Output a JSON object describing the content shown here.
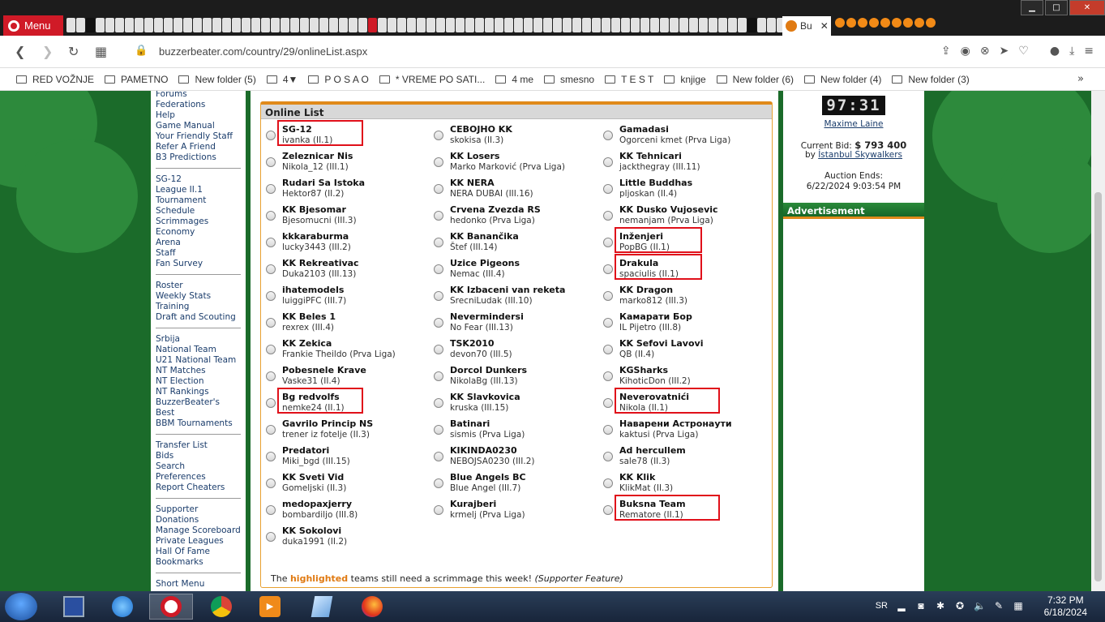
{
  "browser": {
    "menu_label": "Menu",
    "active_tab_title": "Bu",
    "url": "buzzerbeater.com/country/29/onlineList.aspx"
  },
  "bookmarks": [
    "RED VOŽNJE",
    "PAMETNO",
    "New folder (5)",
    "4▼",
    "P O S A O",
    "*  VREME PO SATI...",
    "4 me",
    "smesno",
    "T E S T",
    "knjige",
    "New folder (6)",
    "New folder (4)",
    "New folder (3)"
  ],
  "sidebar": {
    "groups": [
      [
        "Forums",
        "Federations",
        "Help",
        "Game Manual",
        "Your Friendly Staff",
        "Refer A Friend",
        "B3 Predictions"
      ],
      [
        "SG-12",
        "League II.1",
        "Tournament",
        "Schedule",
        "Scrimmages",
        "Economy",
        "Arena",
        "Staff",
        "Fan Survey"
      ],
      [
        "Roster",
        "Weekly Stats",
        "Training",
        "Draft and Scouting"
      ],
      [
        "Srbija",
        "National Team",
        "U21 National Team",
        "NT Matches",
        "NT Election",
        "NT Rankings",
        "BuzzerBeater's Best",
        "BBM Tournaments"
      ],
      [
        "Transfer List",
        "Bids",
        "Search",
        "Preferences",
        "Report Cheaters"
      ],
      [
        "Supporter",
        "Donations",
        "Manage Scoreboard",
        "Private Leagues",
        "Hall Of Fame",
        "Bookmarks"
      ],
      [
        "Short Menu"
      ]
    ]
  },
  "online_list": {
    "title": "Online List",
    "columns": [
      [
        {
          "team": "SG-12",
          "owner": "ivanka (II.1)",
          "highlight": true
        },
        {
          "team": "Zeleznicar Nis",
          "owner": "Nikola_12 (III.1)"
        },
        {
          "team": "Rudari Sa Istoka",
          "owner": "Hektor87 (II.2)"
        },
        {
          "team": "KK Bjesomar",
          "owner": "Bjesomucni (III.3)"
        },
        {
          "team": "kkkaraburma",
          "owner": "lucky3443 (III.2)"
        },
        {
          "team": "KK Rekreativac",
          "owner": "Duka2103 (III.13)"
        },
        {
          "team": "ihatemodels",
          "owner": "luiggiPFC (III.7)"
        },
        {
          "team": "KK Beles 1",
          "owner": "rexrex (III.4)"
        },
        {
          "team": "KK Zekica",
          "owner": "Frankie Theildo (Prva Liga)"
        },
        {
          "team": "Pobesnele Krave",
          "owner": "Vaske31 (II.4)"
        },
        {
          "team": "Bg redvolfs",
          "owner": "nemke24 (II.1)",
          "highlight": true
        },
        {
          "team": "Gavrilo Princip NS",
          "owner": "trener iz fotelje (II.3)"
        },
        {
          "team": "Predatori",
          "owner": "Miki_bgd (III.15)"
        },
        {
          "team": "KK Sveti Vid",
          "owner": "Gomeljski (II.3)"
        },
        {
          "team": "medopaxjerry",
          "owner": "bombardiljo (III.8)"
        },
        {
          "team": "KK Sokolovi",
          "owner": "duka1991 (II.2)"
        }
      ],
      [
        {
          "team": "CEBOJHO KK",
          "owner": "skokisa (II.3)"
        },
        {
          "team": "KK Losers",
          "owner": "Marko Marković (Prva Liga)"
        },
        {
          "team": "KK NERA",
          "owner": "NERA DUBAI (III.16)"
        },
        {
          "team": "Crvena Zvezda RS",
          "owner": "hedonko (Prva Liga)"
        },
        {
          "team": "KK Banančika",
          "owner": "Štef (III.14)"
        },
        {
          "team": "Uzice Pigeons",
          "owner": "Nemac (III.4)"
        },
        {
          "team": "KK Izbaceni van reketa",
          "owner": "SrecniLudak (III.10)"
        },
        {
          "team": "Nevermindersi",
          "owner": "No Fear (III.13)"
        },
        {
          "team": "TSK2010",
          "owner": "devon70 (III.5)"
        },
        {
          "team": "Dorcol Dunkers",
          "owner": "NikolaBg (III.13)"
        },
        {
          "team": "KK Slavkovica",
          "owner": "kruska (III.15)"
        },
        {
          "team": "Batinari",
          "owner": "sismis (Prva Liga)"
        },
        {
          "team": "KIKINDA0230",
          "owner": "NEBOJSA0230 (III.2)"
        },
        {
          "team": "Blue Angels BC",
          "owner": "Blue Angel (III.7)"
        },
        {
          "team": "Kurajberi",
          "owner": "krmelj (Prva Liga)"
        }
      ],
      [
        {
          "team": "Gamadasi",
          "owner": "Ogorceni kmet (Prva Liga)"
        },
        {
          "team": "KK Tehnicari",
          "owner": "jackthegray (III.11)"
        },
        {
          "team": "Little Buddhas",
          "owner": "pljoskan (II.4)"
        },
        {
          "team": "KK Dusko Vujosevic",
          "owner": "nemanjam (Prva Liga)"
        },
        {
          "team": "Inženjeri",
          "owner": "PopBG (II.1)",
          "highlight": true
        },
        {
          "team": "Drakula",
          "owner": "spaciulis (II.1)",
          "highlight": true
        },
        {
          "team": "KK Dragon",
          "owner": "marko812 (III.3)"
        },
        {
          "team": "Камарати Бор",
          "owner": "IL Pijetro (III.8)"
        },
        {
          "team": "KK Sefovi Lavovi",
          "owner": "QB (II.4)"
        },
        {
          "team": "KGSharks",
          "owner": "KihoticDon (III.2)"
        },
        {
          "team": "Neverovatnići",
          "owner": "Nikola (II.1)",
          "highlight": true
        },
        {
          "team": "Наварени Астронаути",
          "owner": "kaktusi (Prva Liga)"
        },
        {
          "team": "Ad hercullem",
          "owner": "sale78 (II.3)"
        },
        {
          "team": "KK Klik",
          "owner": "KlikMat (II.3)"
        },
        {
          "team": "Buksna Team",
          "owner": "Rematore (II.1)",
          "highlight": true
        }
      ]
    ],
    "footnote": {
      "pre": "The",
      "highlighted": "highlighted",
      "post": "teams still need a scrimmage this week!",
      "feature": "(Supporter Feature)"
    }
  },
  "auction": {
    "clock": "97:31",
    "player": "Maxime Laine",
    "current_bid_label": "Current Bid:",
    "current_bid_value": "$ 793 400",
    "by_label": "by",
    "bidder": "İstanbul Skywalkers",
    "ends_label": "Auction Ends:",
    "ends_value": "6/22/2024 9:03:54 PM"
  },
  "advertisement": {
    "title": "Advertisement"
  },
  "taskbar": {
    "language": "SR",
    "time": "7:32 PM",
    "date": "6/18/2024"
  },
  "colors": {
    "highlight_box": "#e0101a",
    "brand_orange": "#e08a1a",
    "page_green": "#1b6b2a"
  }
}
